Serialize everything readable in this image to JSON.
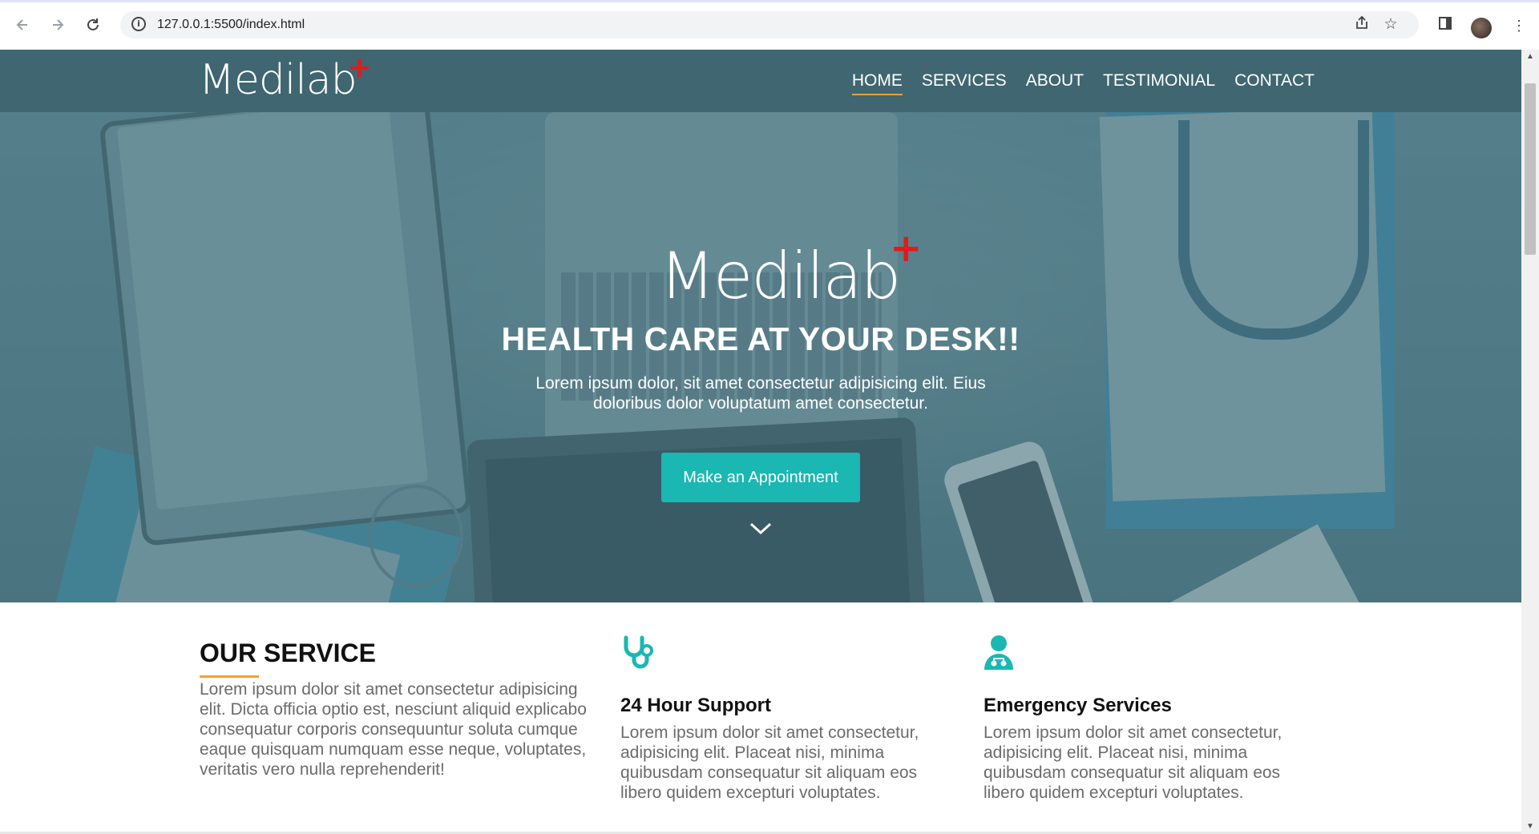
{
  "browser": {
    "url": "127.0.0.1:5500/index.html"
  },
  "site": {
    "logo_text": "Medilab",
    "logo_mark": "+",
    "nav": [
      {
        "label": "HOME",
        "active": true
      },
      {
        "label": "SERVICES",
        "active": false
      },
      {
        "label": "ABOUT",
        "active": false
      },
      {
        "label": "TESTIMONIAL",
        "active": false
      },
      {
        "label": "CONTACT",
        "active": false
      }
    ]
  },
  "hero": {
    "logo_text": "Medilab",
    "logo_mark": "+",
    "title": "HEALTH CARE AT YOUR DESK!!",
    "subtitle": "Lorem ipsum dolor, sit amet consectetur adipisicing elit. Eius doloribus dolor voluptatum amet consectetur.",
    "cta_label": "Make an Appointment"
  },
  "services": {
    "title": "OUR SERVICE",
    "intro": "Lorem ipsum dolor sit amet consectetur adipisicing elit. Dicta officia optio est, nesciunt aliquid explicabo consequatur corporis consequuntur soluta cumque eaque quisquam numquam esse neque, voluptates, veritatis vero nulla reprehenderit!",
    "items": [
      {
        "icon": "stethoscope-icon",
        "title": "24 Hour Support",
        "text": "Lorem ipsum dolor sit amet consectetur, adipisicing elit. Placeat nisi, minima quibusdam consequatur sit aliquam eos libero quidem excepturi voluptates."
      },
      {
        "icon": "doctor-icon",
        "title": "Emergency Services",
        "text": "Lorem ipsum dolor sit amet consectetur, adipisicing elit. Placeat nisi, minima quibusdam consequatur sit aliquam eos libero quidem excepturi voluptates."
      }
    ]
  },
  "colors": {
    "header_bg": "#3f6671",
    "accent_teal": "#1ab7b3",
    "accent_orange": "#f6a12b",
    "logo_plus": "#e21a1a"
  }
}
